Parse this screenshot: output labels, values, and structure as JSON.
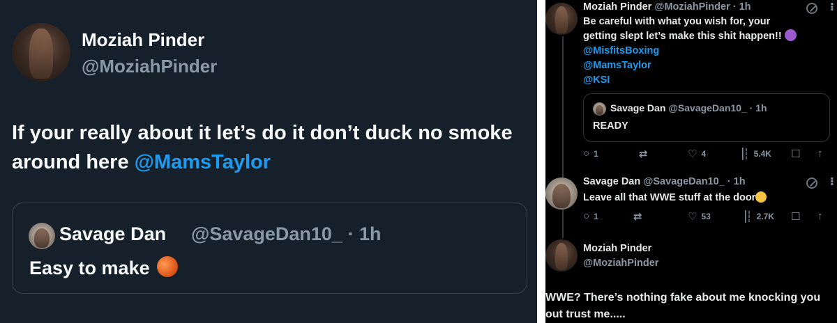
{
  "left_tweet": {
    "author_name": "Moziah Pinder",
    "author_handle": "@MoziahPinder",
    "text": "If your really about it let’s do it don’t duck no smoke around here ",
    "mention": "@MamsTaylor",
    "quote": {
      "author_name": "Savage Dan",
      "author_handle": "@SavageDan10_",
      "time": "· 1h",
      "text": "Easy to make"
    }
  },
  "right_thread": {
    "post1": {
      "author_name": "Moziah Pinder",
      "author_handle": "@MoziahPinder",
      "time": "· 1h",
      "line1": "Be careful with what you wish for, your",
      "line2": "getting slept let’s make this shit happen!!",
      "mentions": [
        "@MisfitsBoxing",
        "@MamsTaylor",
        "@KSI"
      ],
      "quote": {
        "author_name": "Savage Dan",
        "author_handle": "@SavageDan10_",
        "time": "· 1h",
        "text": "READY"
      },
      "actions": {
        "replies": "1",
        "likes": "4",
        "views": "5.4K"
      }
    },
    "post2": {
      "author_name": "Savage Dan",
      "author_handle": "@SavageDan10_",
      "time": "· 1h",
      "text": "Leave all that WWE stuff at the door",
      "actions": {
        "replies": "1",
        "likes": "53",
        "views": "2.7K"
      }
    },
    "post3": {
      "author_name": "Moziah Pinder",
      "author_handle": "@MoziahPinder",
      "text": "WWE? There’s nothing fake about me knocking you out trust me....."
    }
  },
  "icons": {
    "reply": "○",
    "retweet": "⇄",
    "like": "♡",
    "views": "▕┆",
    "bookmark": "☐",
    "share": "↑"
  }
}
